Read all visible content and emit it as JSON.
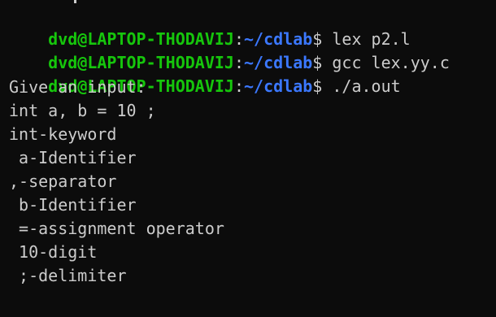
{
  "prompt": {
    "user_host": "dvd@LAPTOP-THODAVIJ",
    "separator": ":",
    "path": "~/cdlab",
    "sign": "$"
  },
  "commands": [
    " lex p2.l",
    " gcc lex.yy.c",
    " ./a.out"
  ],
  "output": [
    "Give an input:",
    "int a, b = 10 ;",
    "int-keyword",
    " a-Identifier",
    ",-separator",
    " b-Identifier",
    " =-assignment operator",
    " 10-digit",
    " ;-delimiter"
  ],
  "colors": {
    "background": "#0c0c0c",
    "text": "#cccccc",
    "user_host": "#16c60c",
    "path": "#3b78ff"
  }
}
